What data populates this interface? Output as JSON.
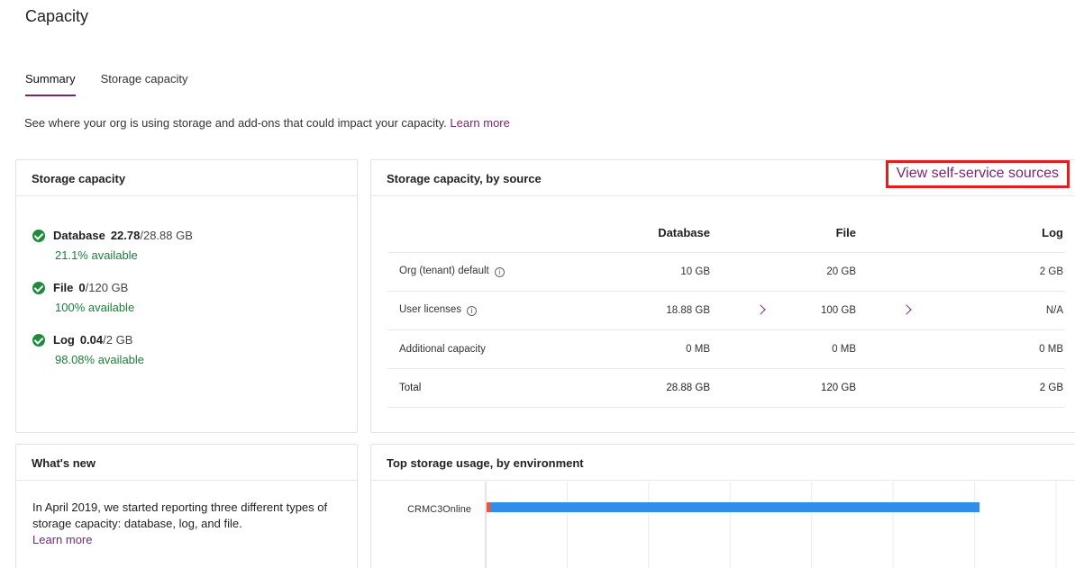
{
  "page": {
    "title": "Capacity"
  },
  "tabs": [
    {
      "label": "Summary",
      "active": true
    },
    {
      "label": "Storage capacity",
      "active": false
    }
  ],
  "description": {
    "text": "See where your org is using storage and add-ons that could impact your capacity.",
    "link": "Learn more"
  },
  "storage_capacity": {
    "title": "Storage capacity",
    "items": [
      {
        "name": "Database",
        "used": "22.78",
        "total": "/28.88 GB",
        "available": "21.1% available"
      },
      {
        "name": "File",
        "used": "0",
        "total": "/120 GB",
        "available": "100% available"
      },
      {
        "name": "Log",
        "used": "0.04",
        "total": "/2 GB",
        "available": "98.08% available"
      }
    ]
  },
  "by_source": {
    "title": "Storage capacity, by source",
    "view_link": "View self-service sources",
    "columns": [
      "",
      "Database",
      "",
      "File",
      "",
      "Log"
    ],
    "rows": [
      {
        "name": "Org (tenant) default",
        "db": "10 GB",
        "file": "20 GB",
        "log": "2 GB"
      },
      {
        "name": "User licenses",
        "db": "18.88 GB",
        "file": "100 GB",
        "log": "N/A"
      },
      {
        "name": "Additional capacity",
        "db": "0 MB",
        "file": "0 MB",
        "log": "0 MB"
      },
      {
        "name": "Total",
        "db": "28.88 GB",
        "file": "120 GB",
        "log": "2 GB"
      }
    ]
  },
  "whats_new": {
    "title": "What's new",
    "text": "In April 2019, we started reporting three different types of storage capacity: database, log, and file.",
    "link": "Learn more"
  },
  "top_usage": {
    "title": "Top storage usage, by environment"
  },
  "chart_data": {
    "type": "bar",
    "orientation": "horizontal",
    "stacked": true,
    "categories": [
      "CRMC3Online"
    ],
    "series": [
      {
        "values": [
          0.5
        ],
        "color": "#e8573c"
      },
      {
        "values": [
          60
        ],
        "color": "#2e8ee8"
      }
    ],
    "xlim": [
      0,
      70
    ],
    "grid": true
  }
}
